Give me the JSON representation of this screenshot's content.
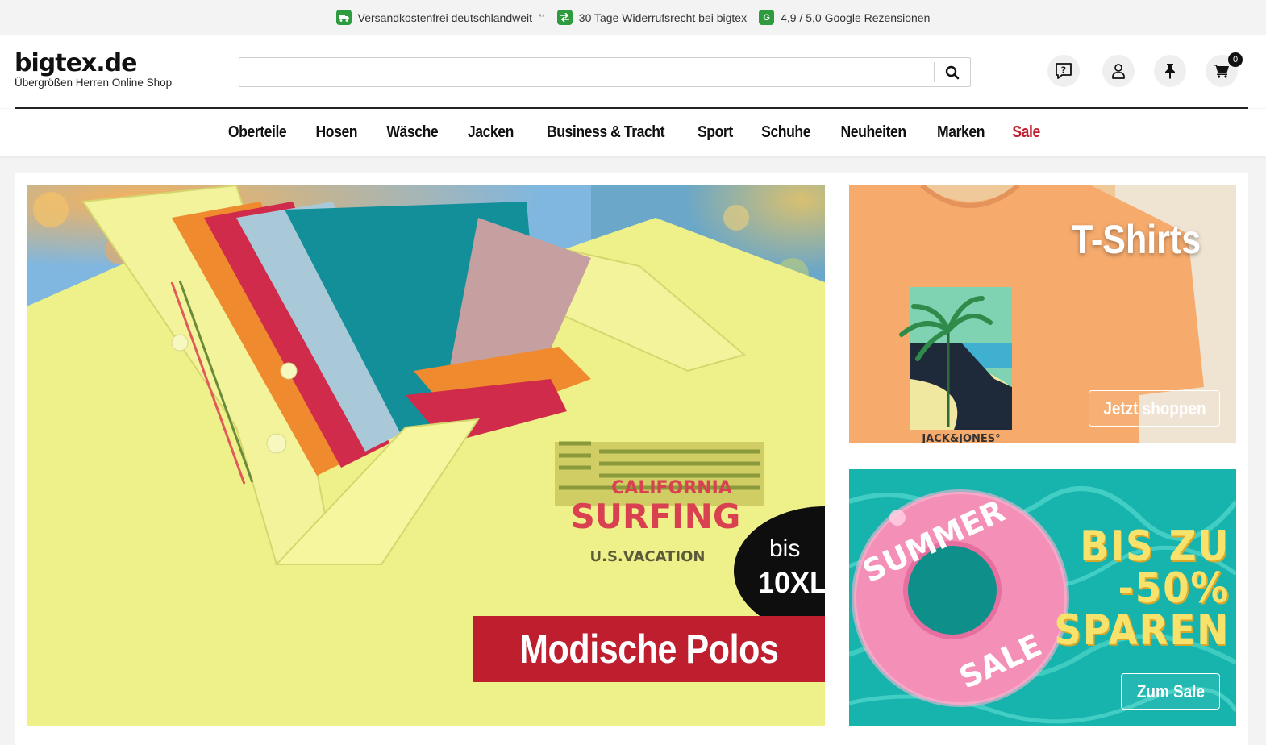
{
  "topbar": {
    "items": [
      {
        "icon": "truck-icon",
        "text": "Versandkostenfrei deutschlandweit",
        "suffix": "**"
      },
      {
        "icon": "return-arrows-icon",
        "text": "30 Tage Widerrufsrecht bei bigtex"
      },
      {
        "icon": "google-icon",
        "text": "4,9 / 5,0 Google Rezensionen"
      }
    ]
  },
  "header": {
    "logo_brand": "bigtex.de",
    "logo_claim": "Übergrößen Herren Online Shop",
    "search_placeholder": "",
    "cart_count": "0"
  },
  "nav": {
    "items": [
      "Oberteile",
      "Hosen",
      "Wäsche",
      "Jacken",
      "Business & Tracht",
      "Sport",
      "Schuhe",
      "Neuheiten",
      "Marken",
      "Sale"
    ]
  },
  "hero": {
    "cta": "Modische Polos",
    "badge_line1": "bis",
    "badge_line2": "10XL",
    "shirt_print_line1": "CALIFORNIA",
    "shirt_print_line2": "SURFING",
    "shirt_print_line3": "U.S.VACATION"
  },
  "tshirts": {
    "title": "T-Shirts",
    "button": "Jetzt shoppen",
    "brand_print": "JACK&JONES°"
  },
  "summer": {
    "ring_text_top": "SUMMER",
    "ring_text_bottom": "SALE",
    "line1": "BIS ZU",
    "line2": "-50%",
    "line3": "SPAREN",
    "button": "Zum Sale"
  },
  "colors": {
    "accent_green": "#2e9b3f",
    "sale_red": "#c01d2e",
    "cta_red": "#bf1e2e"
  }
}
